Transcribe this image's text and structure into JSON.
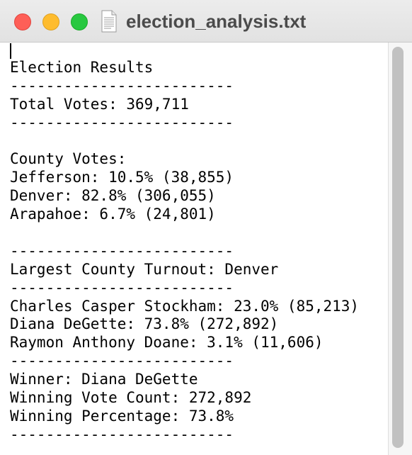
{
  "window": {
    "title": "election_analysis.txt",
    "file_icon": "text-document-icon"
  },
  "document": {
    "lines": [
      "Election Results",
      "-------------------------",
      "Total Votes: 369,711",
      "-------------------------",
      "",
      "County Votes:",
      "Jefferson: 10.5% (38,855)",
      "Denver: 82.8% (306,055)",
      "Arapahoe: 6.7% (24,801)",
      "",
      "-------------------------",
      "Largest County Turnout: Denver",
      "-------------------------",
      "Charles Casper Stockham: 23.0% (85,213)",
      "Diana DeGette: 73.8% (272,892)",
      "Raymon Anthony Doane: 3.1% (11,606)",
      "-------------------------",
      "Winner: Diana DeGette",
      "Winning Vote Count: 272,892",
      "Winning Percentage: 73.8%",
      "-------------------------"
    ]
  },
  "colors": {
    "close": "#fe5f57",
    "minimize": "#febc2e",
    "zoom": "#28c840"
  }
}
